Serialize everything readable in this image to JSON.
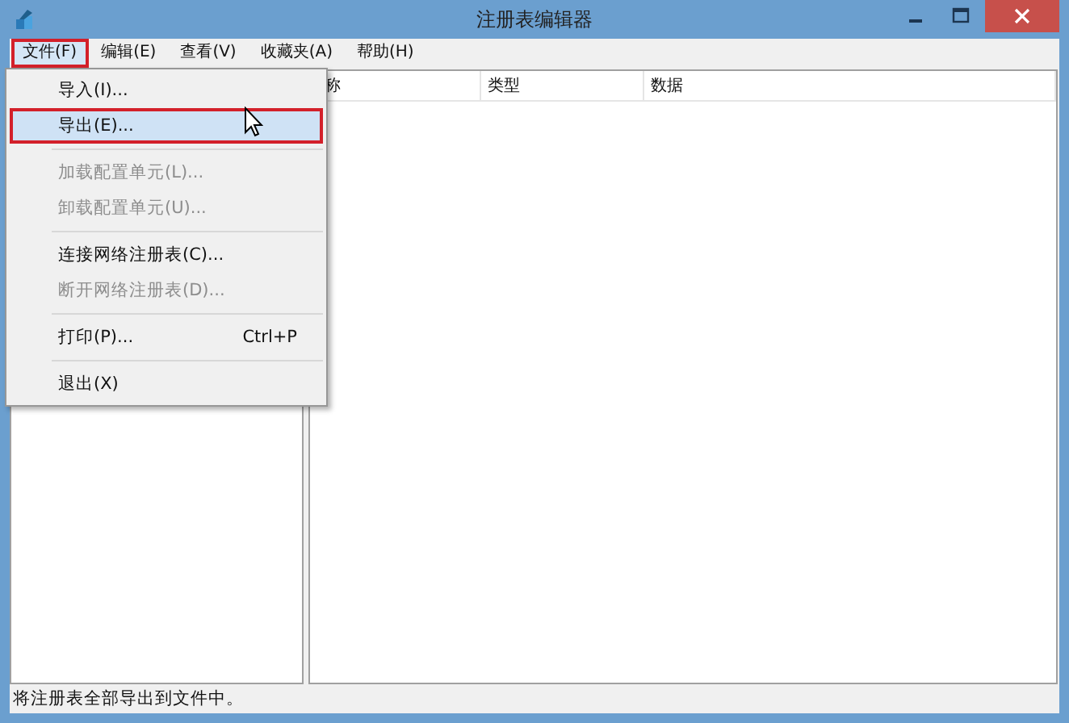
{
  "window": {
    "title": "注册表编辑器"
  },
  "menubar": [
    {
      "label": "文件(F)",
      "selected": true
    },
    {
      "label": "编辑(E)",
      "selected": false
    },
    {
      "label": "查看(V)",
      "selected": false
    },
    {
      "label": "收藏夹(A)",
      "selected": false
    },
    {
      "label": "帮助(H)",
      "selected": false
    }
  ],
  "menu": [
    {
      "kind": "item",
      "label": "导入(I)...",
      "disabled": false,
      "selected": false
    },
    {
      "kind": "item",
      "label": "导出(E)...",
      "disabled": false,
      "selected": true
    },
    {
      "kind": "separator"
    },
    {
      "kind": "item",
      "label": "加载配置单元(L)...",
      "disabled": true,
      "selected": false
    },
    {
      "kind": "item",
      "label": "卸载配置单元(U)...",
      "disabled": true,
      "selected": false
    },
    {
      "kind": "separator"
    },
    {
      "kind": "item",
      "label": "连接网络注册表(C)...",
      "disabled": false,
      "selected": false
    },
    {
      "kind": "item",
      "label": "断开网络注册表(D)...",
      "disabled": true,
      "selected": false
    },
    {
      "kind": "separator"
    },
    {
      "kind": "item",
      "label": "打印(P)...",
      "shortcut": "Ctrl+P",
      "disabled": false,
      "selected": false
    },
    {
      "kind": "separator"
    },
    {
      "kind": "item",
      "label": "退出(X)",
      "disabled": false,
      "selected": false
    }
  ],
  "table": {
    "columns": [
      "称",
      "类型",
      "数据"
    ]
  },
  "status_bar": "将注册表全部导出到文件中。"
}
